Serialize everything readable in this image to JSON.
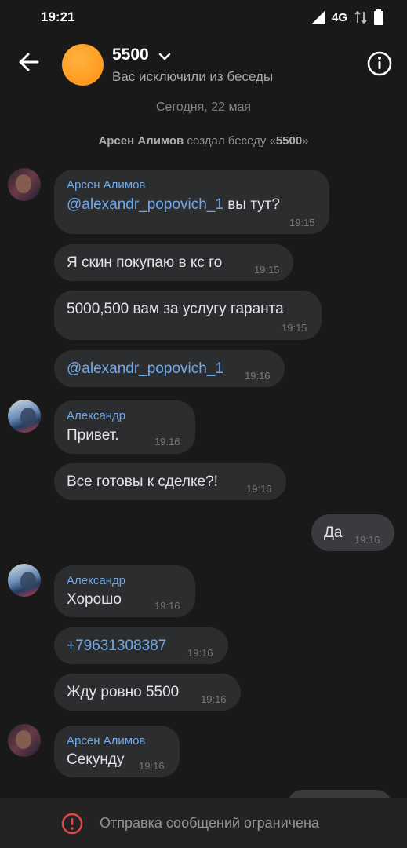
{
  "status_bar": {
    "time": "19:21",
    "network": "4G"
  },
  "header": {
    "title": "5500",
    "subtitle": "Вас исключили из беседы"
  },
  "chat": {
    "date": "Сегодня, 22 мая",
    "system_message": {
      "actor": "Арсен Алимов",
      "text_before": " создал беседу «",
      "chat_name": "5500",
      "text_after": "»"
    },
    "messages": [
      {
        "sender": "Арсен Алимов",
        "mention": "@alexandr_popovich_1",
        "text": " вы тут?",
        "time": "19:15"
      },
      {
        "text": "Я скин покупаю в кс го",
        "time": "19:15"
      },
      {
        "text": "5000,500 вам за услугу гаранта",
        "time": "19:15"
      },
      {
        "text": "@alexandr_popovich_1",
        "time": "19:16"
      },
      {
        "sender": "Александр",
        "text": "Привет.",
        "time": "19:16"
      },
      {
        "text": "Все готовы к сделке?!",
        "time": "19:16"
      },
      {
        "text": "Да",
        "time": "19:16",
        "outgoing": true
      },
      {
        "sender": "Александр",
        "text": "Хорошо",
        "time": "19:16"
      },
      {
        "text": "+79631308387",
        "time": "19:16"
      },
      {
        "text": "Жду ровно 5500",
        "time": "19:16"
      },
      {
        "sender": "Арсен Алимов",
        "text": "Секунду",
        "time": "19:16"
      }
    ]
  },
  "footer": {
    "text": "Отправка сообщений ограничена"
  },
  "colors": {
    "background": "#19191a",
    "bubble": "#2c2d2f",
    "link": "#71aaeb",
    "avatar_orange": "#ff9a1f",
    "alert_red": "#e64646"
  }
}
